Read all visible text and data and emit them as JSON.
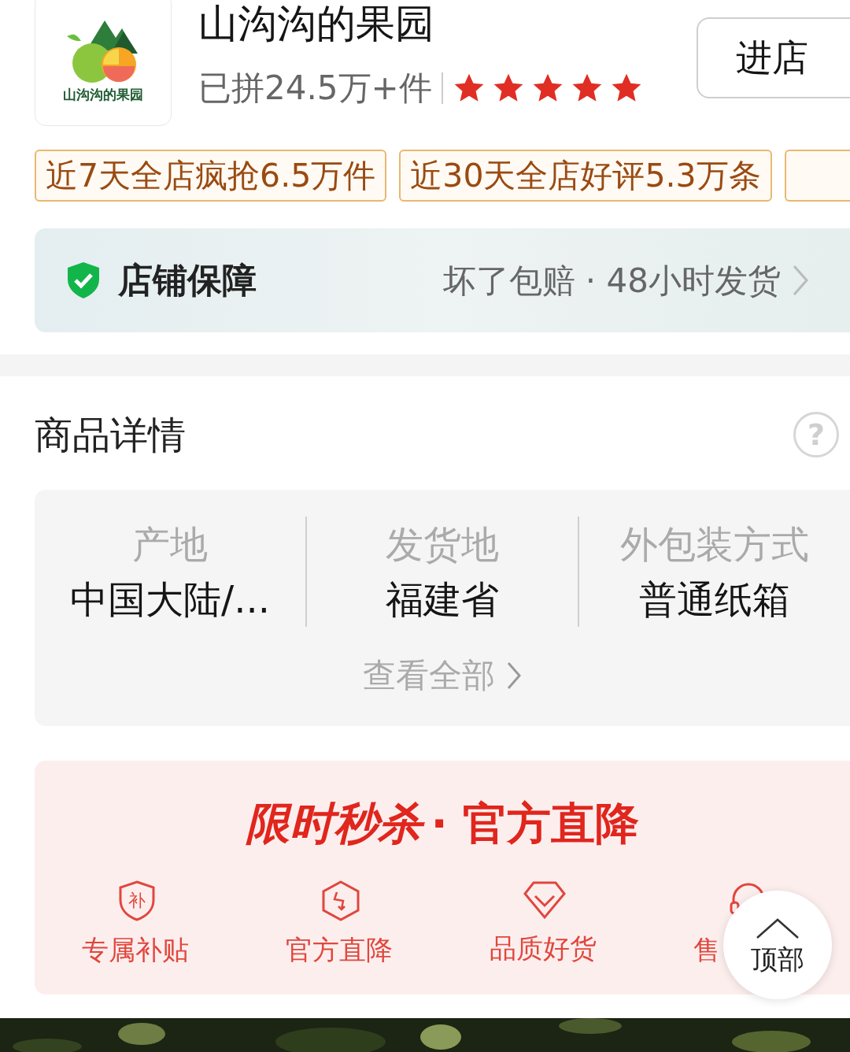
{
  "shop": {
    "logo_text": "山沟沟的果园",
    "name": "山沟沟的果园",
    "sales": "已拼24.5万+件",
    "stars": 5,
    "enter_button": "进店"
  },
  "tags": [
    "近7天全店疯抢6.5万件",
    "近30天全店好评5.3万条"
  ],
  "guarantee": {
    "title": "店铺保障",
    "detail": "坏了包赔 · 48小时发货"
  },
  "details": {
    "title": "商品详情",
    "help": "?",
    "specs": [
      {
        "label": "产地",
        "value": "中国大陆/..."
      },
      {
        "label": "发货地",
        "value": "福建省"
      },
      {
        "label": "外包装方式",
        "value": "普通纸箱"
      }
    ],
    "view_all": "查看全部"
  },
  "promo": {
    "title_left": "限时秒杀",
    "title_right": "· 官方直降",
    "features": [
      {
        "kind": "subsidy",
        "glyph": "补",
        "label": "专属补贴"
      },
      {
        "kind": "price-drop",
        "label": "官方直降"
      },
      {
        "kind": "quality",
        "label": "品质好货"
      },
      {
        "kind": "service",
        "label": "售"
      }
    ]
  },
  "top_button": "顶部"
}
